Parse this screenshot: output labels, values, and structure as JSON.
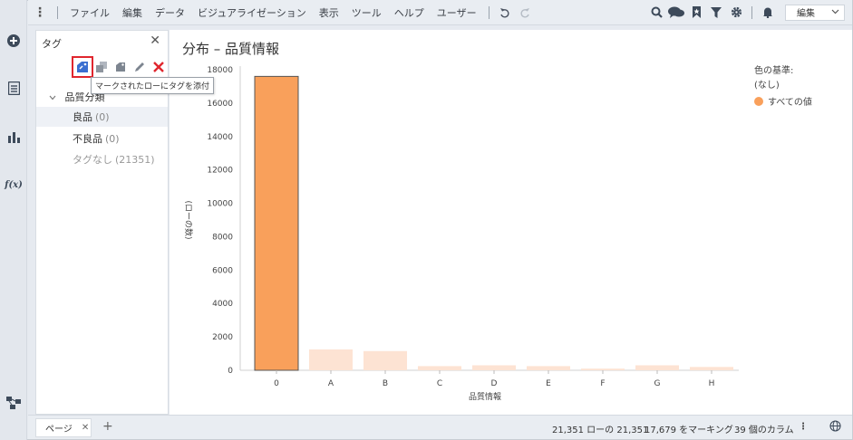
{
  "menubar": {
    "items": [
      "ファイル",
      "編集",
      "データ",
      "ビジュアライゼーション",
      "表示",
      "ツール",
      "ヘルプ",
      "ユーザー"
    ],
    "mode_select": "編集"
  },
  "rail": {
    "icons": [
      "add-icon",
      "data-table-icon",
      "visualization-icon",
      "expression-icon",
      "data-flow-icon"
    ],
    "fx_glyph": "f(x)"
  },
  "tags_panel": {
    "title": "タグ",
    "tooltip": "マークされたローにタグを添付",
    "collection": "品質分類",
    "tags": [
      {
        "name": "良品",
        "count": "(0)",
        "selected": true
      },
      {
        "name": "不良品",
        "count": "(0)",
        "selected": false
      },
      {
        "name": "タグなし",
        "count": "(21351)",
        "muted": true
      }
    ]
  },
  "chart_panel": {
    "title": "分布 – 品質情報",
    "legend_title": "色の基準:",
    "legend_sub": "(なし)",
    "legend_item": "すべての値",
    "colors": {
      "marked": "#f9a05b",
      "unmarked": "#fde3d3"
    }
  },
  "chart_data": {
    "type": "bar",
    "xlabel": "品質情報",
    "ylabel": "(ローの数)",
    "categories": [
      "0",
      "A",
      "B",
      "C",
      "D",
      "E",
      "F",
      "G",
      "H"
    ],
    "values": [
      17600,
      1250,
      1150,
      250,
      300,
      250,
      100,
      300,
      200
    ],
    "marked": [
      true,
      false,
      false,
      false,
      false,
      false,
      false,
      false,
      false
    ],
    "ylim": [
      0,
      18000
    ],
    "yticks": [
      0,
      2000,
      4000,
      6000,
      8000,
      10000,
      12000,
      14000,
      16000,
      18000
    ],
    "legend": "top-right"
  },
  "bottombar": {
    "page_tab": "ページ",
    "status_rows": "21,351 ローの 21,351",
    "status_marked": "17,679 をマーキング",
    "status_columns": "39 個のカラム"
  }
}
